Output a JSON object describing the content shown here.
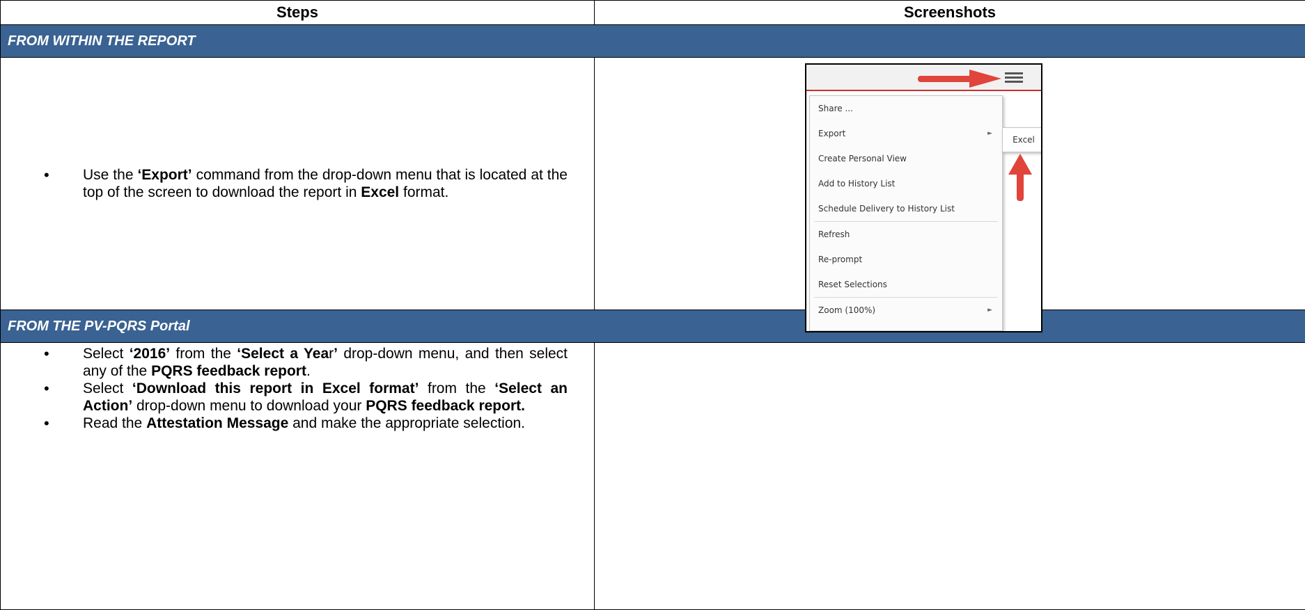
{
  "header": {
    "steps": "Steps",
    "screenshots": "Screenshots"
  },
  "section1": {
    "title": "FROM WITHIN THE REPORT",
    "bullet": {
      "t1": "Use the ",
      "b1": "‘Export’",
      "t2": " command from the drop-down menu that is located at the top of the screen to download the report in ",
      "b2": "Excel",
      "t3": " format."
    },
    "screenshot": {
      "accent_color": "#c8312e",
      "arrow_color": "#e0443a",
      "menu_items": [
        "Share ...",
        "Export",
        "Create Personal View",
        "Add to History List",
        "Schedule Delivery to History List",
        "Refresh",
        "Re-prompt",
        "Reset Selections",
        "Zoom (100%)"
      ],
      "submenu_item": "Excel",
      "submenu_arrow": "►"
    }
  },
  "section2": {
    "title": "FROM THE PV-PQRS Portal",
    "bullets": [
      {
        "a": "Select ",
        "b": "‘2016’",
        "c": " from the ",
        "d": "‘Select a Yea",
        "e": "r",
        "f": "’",
        "g": " drop-down menu, and then select any of the ",
        "h": "PQRS feedback report",
        "i": "."
      },
      {
        "a": "Select ",
        "b": "‘Download this report in Excel format’",
        "c": " from the ",
        "d": "‘Select an Action’",
        "e": " drop-down menu to download your ",
        "f": "PQRS feedback report."
      },
      {
        "a": "Read the ",
        "b": "Attestation Message",
        "c": " and make the appropriate selection."
      }
    ]
  },
  "band_color": "#3a6292"
}
